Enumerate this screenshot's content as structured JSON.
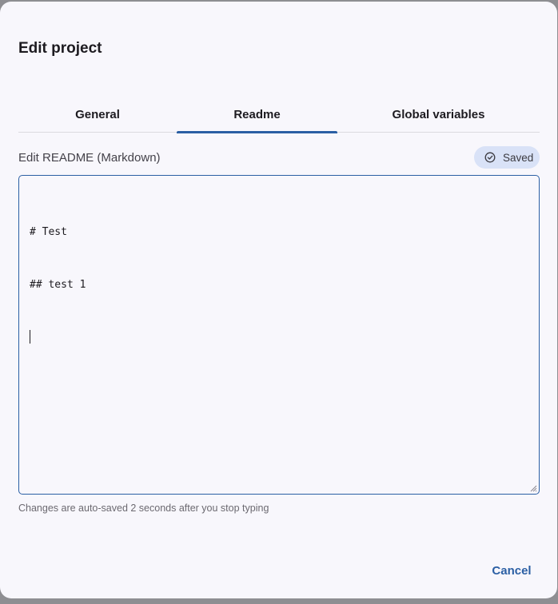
{
  "dialog": {
    "title": "Edit project"
  },
  "tabs": [
    {
      "label": "General"
    },
    {
      "label": "Readme",
      "active": true
    },
    {
      "label": "Global variables"
    }
  ],
  "readme": {
    "label": "Edit README (Markdown)",
    "status": "Saved",
    "status_icon": "check-circle-icon",
    "lines": [
      "# Test",
      "## test 1",
      ""
    ],
    "hint": "Changes are auto-saved 2 seconds after you stop typing"
  },
  "footer": {
    "cancel_label": "Cancel"
  },
  "colors": {
    "accent": "#2b5fa4",
    "chip_bg": "#d9e2f7",
    "surface": "#f8f7fc"
  }
}
